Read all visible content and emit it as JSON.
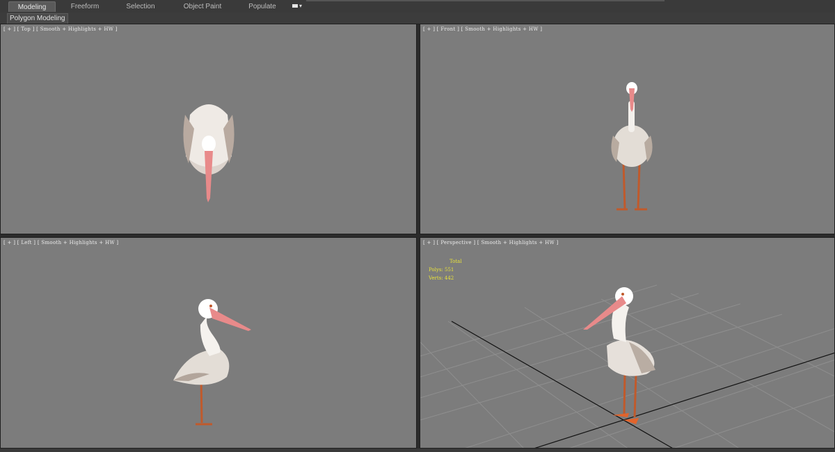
{
  "ribbon": {
    "tabs": [
      {
        "label": "Modeling",
        "active": true
      },
      {
        "label": "Freeform",
        "active": false
      },
      {
        "label": "Selection",
        "active": false
      },
      {
        "label": "Object Paint",
        "active": false
      },
      {
        "label": "Populate",
        "active": false
      }
    ]
  },
  "subpanel": {
    "label": "Polygon Modeling"
  },
  "viewports": {
    "top": {
      "label": "[ + ] [ Top ] [ Smooth + Highlights + HW ]"
    },
    "front": {
      "label": "[ + ] [ Front ] [ Smooth + Highlights + HW ]"
    },
    "left": {
      "label": "[ + ] [ Left ] [ Smooth + Highlights + HW ]"
    },
    "perspective": {
      "label": "[ + ] [ Perspective ] [ Smooth + Highlights + HW ]",
      "stats": {
        "title": "Total",
        "polys": "Polys: 551",
        "verts": "Verts: 442"
      }
    }
  },
  "colors": {
    "viewport_bg": "#7c7c7c",
    "beak": "#e88a8a",
    "legs": "#c05a2c",
    "body": "#e8e2dc",
    "stats_text": "#e8e23a"
  }
}
